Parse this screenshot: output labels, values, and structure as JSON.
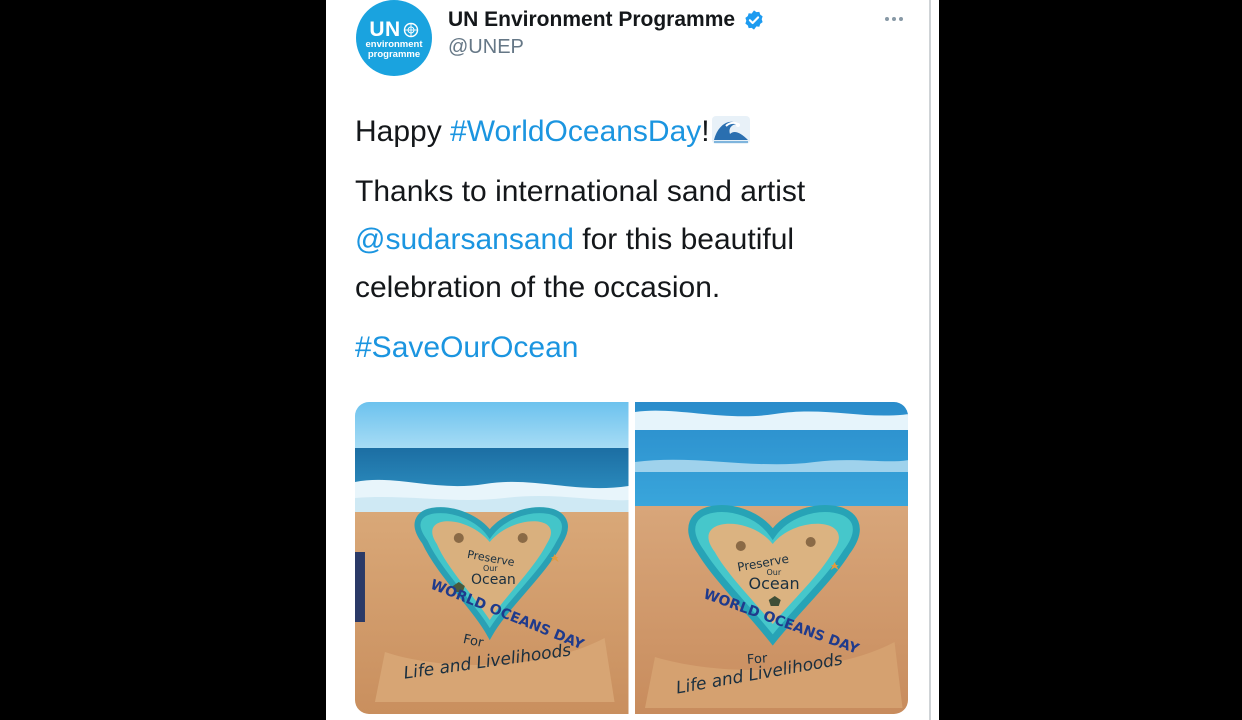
{
  "tweet": {
    "display_name": "UN Environment Programme",
    "handle": "@UNEP",
    "avatar": {
      "logo_top": "UN",
      "logo_sub_line1": "environment",
      "logo_sub_line2": "programme"
    },
    "verified_icon": "verified-badge-icon",
    "more_icon": "more-options-icon",
    "line1_prefix": "Happy ",
    "line1_hashtag": "#WorldOceansDay",
    "line1_suffix": "!",
    "emoji": "wave-emoji-icon",
    "line2_text": "Thanks to international sand artist",
    "line2_mention": "@sudarsansand",
    "line2_rest": " for this beautiful",
    "line3_text": "celebration of the occasion.",
    "hashtag2": "#SaveOurOcean"
  },
  "media": {
    "photos": [
      {
        "sculpture": {
          "preserve": "Preserve",
          "our": "Our",
          "ocean": "Ocean",
          "world_oceans_day": "WORLD OCEANS DAY",
          "for": "For",
          "life_livelihoods": "Life and Livelihoods"
        }
      },
      {
        "sculpture": {
          "preserve": "Preserve",
          "our": "Our",
          "ocean": "Ocean",
          "world_oceans_day": "WORLD OCEANS DAY",
          "for": "For",
          "life_livelihoods": "Life and Livelihoods"
        }
      }
    ]
  },
  "colors": {
    "link": "#1b95e0",
    "brand_blue": "#1aa3df",
    "verified": "#1d9bf0",
    "text": "#14171a",
    "secondary": "#657786"
  }
}
